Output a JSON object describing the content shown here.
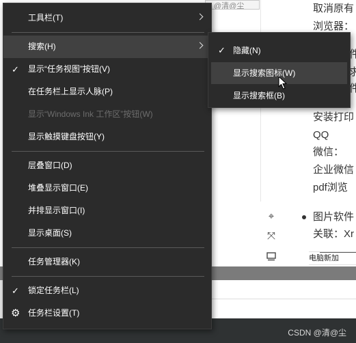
{
  "background": {
    "doc_tail_text": "@清@尘",
    "doc_lines": [
      "取消原有",
      "浏览器：",
      "件",
      "求",
      "件",
      "安装打印",
      "QQ",
      "微信：",
      "企业微信",
      "pdf浏览",
      "图片软件",
      "关联：Xr"
    ],
    "icons": [
      "target-icon",
      "move-icon",
      "monitor-icon"
    ],
    "breadcrumb": {
      "item1": "电脑",
      "separator": "›",
      "item2": "新加"
    },
    "watermark": "CSDN @清@尘"
  },
  "menu": {
    "toolbars": "工具栏(T)",
    "search": "搜索(H)",
    "show_task_view": "显示“任务视图”按钮(V)",
    "show_people": "在任务栏上显示人脉(P)",
    "show_ink": "显示“Windows Ink 工作区”按钮(W)",
    "show_touch_keyboard": "显示触摸键盘按钮(Y)",
    "cascade": "层叠窗口(D)",
    "stacked": "堆叠显示窗口(E)",
    "side_by_side": "并排显示窗口(I)",
    "show_desktop": "显示桌面(S)",
    "task_manager": "任务管理器(K)",
    "lock_taskbar": "锁定任务栏(L)",
    "taskbar_settings": "任务栏设置(T)",
    "check_mark": "✓",
    "gear_glyph": "⚙"
  },
  "submenu": {
    "hidden": "隐藏(N)",
    "show_search_icon": "显示搜索图标(W)",
    "show_search_box": "显示搜索框(B)"
  }
}
